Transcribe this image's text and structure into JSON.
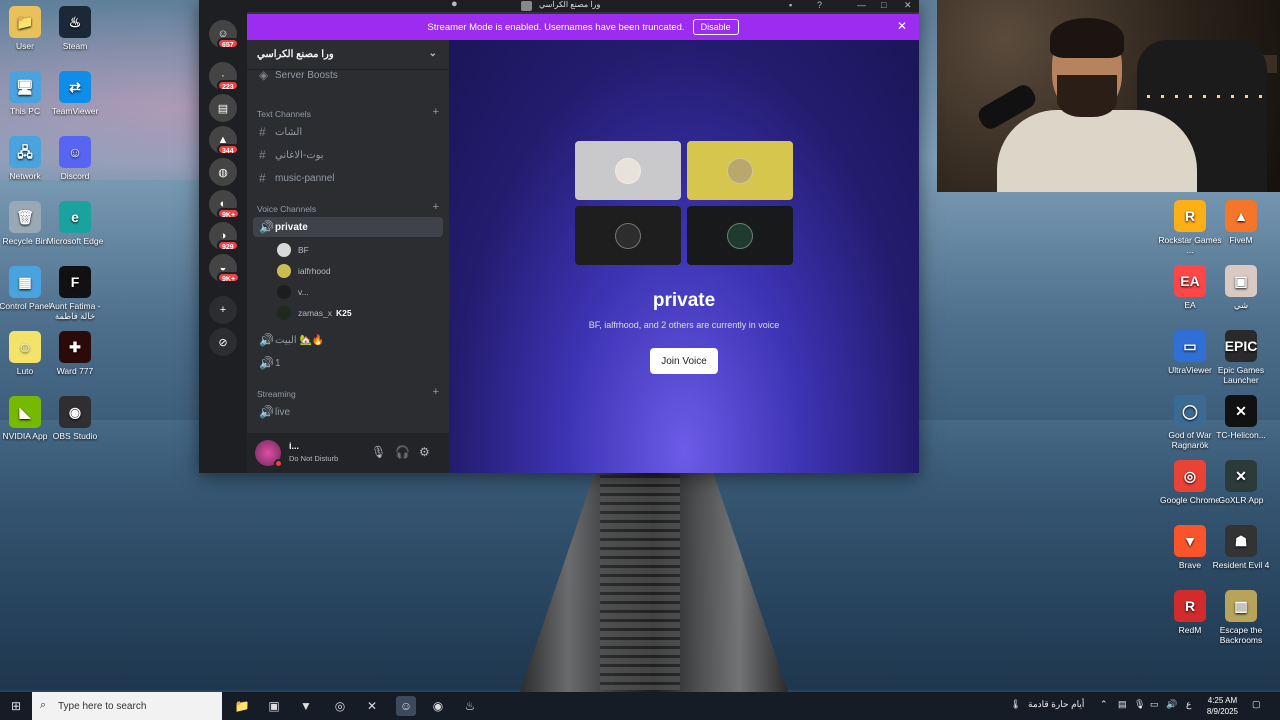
{
  "desktop": {
    "left_icons": [
      {
        "label": "User",
        "glyph": "📁",
        "color": "#e8c15a"
      },
      {
        "label": "Steam",
        "glyph": "♨",
        "color": "#1b2838"
      },
      {
        "label": "This PC",
        "glyph": "🖥",
        "color": "#4aa3df"
      },
      {
        "label": "TeamViewer",
        "glyph": "⇄",
        "color": "#0e8ee9"
      },
      {
        "label": "Network",
        "glyph": "🖧",
        "color": "#4aa3df"
      },
      {
        "label": "Discord",
        "glyph": "☺",
        "color": "#5865f2"
      },
      {
        "label": "Recycle Bin",
        "glyph": "🗑",
        "color": "#9aa7b5"
      },
      {
        "label": "Microsoft Edge",
        "glyph": "e",
        "color": "#1aa39e"
      },
      {
        "label": "Control Panel",
        "glyph": "▦",
        "color": "#4aa3df"
      },
      {
        "label": "Aunt Fatima - خالة فاطمة",
        "glyph": "F",
        "color": "#111111"
      },
      {
        "label": "Luto",
        "glyph": "☺",
        "color": "#f3e36b"
      },
      {
        "label": "Ward 777",
        "glyph": "✚",
        "color": "#2b0a0a"
      },
      {
        "label": "NVIDIA App",
        "glyph": "◣",
        "color": "#76b900"
      },
      {
        "label": "OBS Studio",
        "glyph": "◉",
        "color": "#302e31"
      }
    ],
    "right_icons": [
      {
        "label": "Rockstar Games ...",
        "glyph": "R",
        "color": "#fcaf17"
      },
      {
        "label": "FiveM",
        "glyph": "▲",
        "color": "#f4762a"
      },
      {
        "label": "EA",
        "glyph": "EA",
        "color": "#ff4747"
      },
      {
        "label": "شي",
        "glyph": "▣",
        "color": "#d9c9c0"
      },
      {
        "label": "UltraViewer",
        "glyph": "▭",
        "color": "#2f6fd6"
      },
      {
        "label": "Epic Games Launcher",
        "glyph": "EPIC",
        "color": "#2a2a2a"
      },
      {
        "label": "God of War Ragnarök",
        "glyph": "◯",
        "color": "#3b6a93"
      },
      {
        "label": "TC-Helicon...",
        "glyph": "✕",
        "color": "#111111"
      },
      {
        "label": "Google Chrome",
        "glyph": "◎",
        "color": "#ea4335"
      },
      {
        "label": "GoXLR App",
        "glyph": "✕",
        "color": "#2a3b3a"
      },
      {
        "label": "Brave",
        "glyph": "▼",
        "color": "#fb542b"
      },
      {
        "label": "Resident Evil 4",
        "glyph": "☗",
        "color": "#333333"
      },
      {
        "label": "RedM",
        "glyph": "R",
        "color": "#d22b2b"
      },
      {
        "label": "Escape the Backrooms",
        "glyph": "▥",
        "color": "#b7a35a"
      }
    ]
  },
  "discord": {
    "window_title": "ورا مصنع الكراسي",
    "streamer_banner": {
      "text": "Streamer Mode is enabled. Usernames have been truncated.",
      "disable_label": "Disable",
      "close_glyph": "✕"
    },
    "guilds": [
      {
        "badge": "657",
        "glyph": "☺"
      },
      {
        "badge": "223",
        "glyph": "·"
      },
      {
        "badge": "",
        "glyph": "▤"
      },
      {
        "badge": "344",
        "glyph": "▲"
      },
      {
        "badge": "",
        "glyph": "◍"
      },
      {
        "badge": "9K+",
        "glyph": "◐"
      },
      {
        "badge": "929",
        "glyph": "◑"
      },
      {
        "badge": "9K+",
        "glyph": "◒"
      }
    ],
    "add_server_glyph": "+",
    "explore_glyph": "⊘",
    "server_name": "ورا مصنع الكراسي",
    "server_boosts_label": "Server Boosts",
    "text_category": "Text Channels",
    "text_channels": [
      "الشات",
      "بوت-الاغاني",
      "music-pannel"
    ],
    "voice_category": "Voice Channels",
    "active_voice_channel": "private",
    "voice_members": [
      {
        "name": "BF",
        "color": "#d8d8d8"
      },
      {
        "name": "ialfrhood",
        "color": "#cbbd55"
      },
      {
        "name": "v...",
        "color": "#1d1d1d"
      },
      {
        "name": "zamas_x",
        "color": "#1d2a1d",
        "extra": "K25"
      }
    ],
    "other_voice_channels": [
      "البيت 🏡🔥",
      "1"
    ],
    "streaming_category": "Streaming",
    "streaming_channels": [
      "live"
    ],
    "user_panel": {
      "name": "i...",
      "status": "Do Not Disturb"
    },
    "voice_view": {
      "title": "private",
      "subtitle": "BF, ialfrhood, and 2 others are currently in voice",
      "join_label": "Join Voice",
      "tiles": [
        {
          "bg": "#c9c9cc",
          "face": "#e8e2da"
        },
        {
          "bg": "#d6c64e",
          "face": "#b9a86c"
        },
        {
          "bg": "#1e1e1e",
          "face": "#2d2d2d"
        },
        {
          "bg": "#17191a",
          "face": "#1e3b2e"
        }
      ]
    }
  },
  "taskbar": {
    "search_placeholder": "Type here to search",
    "weather_text": "أيام حارة قادمة",
    "language": "ع",
    "time": "4:25 AM",
    "date": "8/9/2025"
  }
}
